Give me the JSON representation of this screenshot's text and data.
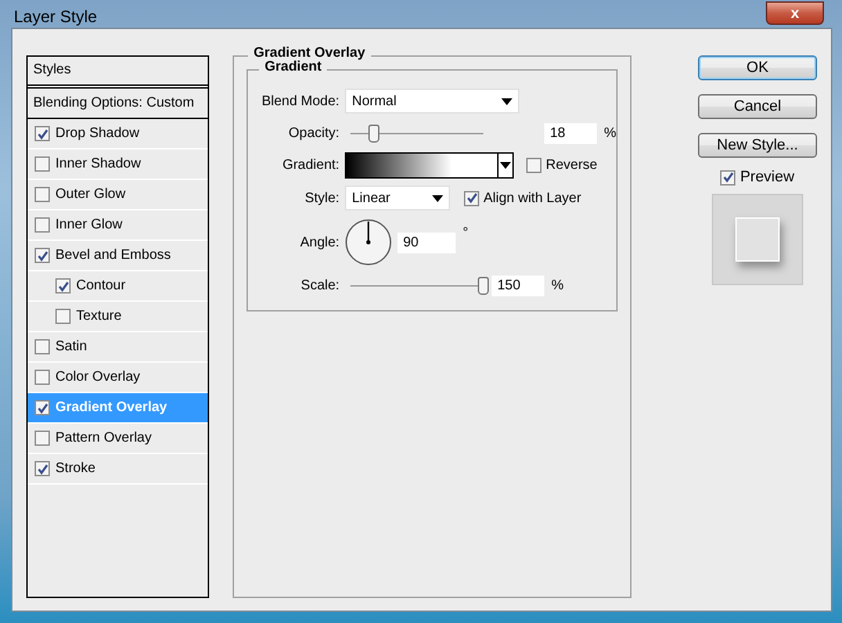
{
  "window": {
    "title": "Layer Style",
    "close": "x"
  },
  "sidebar": {
    "header": "Styles",
    "blending": "Blending Options: Custom",
    "items": [
      {
        "label": "Drop Shadow",
        "checked": true,
        "selected": false
      },
      {
        "label": "Inner Shadow",
        "checked": false,
        "selected": false
      },
      {
        "label": "Outer Glow",
        "checked": false,
        "selected": false
      },
      {
        "label": "Inner Glow",
        "checked": false,
        "selected": false
      },
      {
        "label": "Bevel and Emboss",
        "checked": true,
        "selected": false,
        "children": [
          {
            "label": "Contour",
            "checked": true,
            "selected": false
          },
          {
            "label": "Texture",
            "checked": false,
            "selected": false
          }
        ]
      },
      {
        "label": "Satin",
        "checked": false,
        "selected": false
      },
      {
        "label": "Color Overlay",
        "checked": false,
        "selected": false
      },
      {
        "label": "Gradient Overlay",
        "checked": true,
        "selected": true
      },
      {
        "label": "Pattern Overlay",
        "checked": false,
        "selected": false
      },
      {
        "label": "Stroke",
        "checked": true,
        "selected": false
      }
    ]
  },
  "panel": {
    "title": "Gradient Overlay",
    "group": "Gradient",
    "blend_mode": {
      "label": "Blend Mode:",
      "value": "Normal"
    },
    "opacity": {
      "label": "Opacity:",
      "level": 0.18,
      "value": "18",
      "unit": "%"
    },
    "gradient": {
      "label": "Gradient:",
      "reverse": {
        "label": "Reverse",
        "checked": false
      }
    },
    "style": {
      "label": "Style:",
      "value": "Linear",
      "align": {
        "label": "Align with Layer",
        "checked": true
      }
    },
    "angle": {
      "label": "Angle:",
      "value": "90",
      "unit": "°"
    },
    "scale": {
      "label": "Scale:",
      "level": 1,
      "value": "150",
      "unit": "%"
    }
  },
  "buttons": [
    {
      "label": "OK",
      "default": true
    },
    {
      "label": "Cancel",
      "default": false
    },
    {
      "label": "New Style...",
      "default": false
    }
  ],
  "preview": {
    "label": "Preview",
    "checked": true
  }
}
